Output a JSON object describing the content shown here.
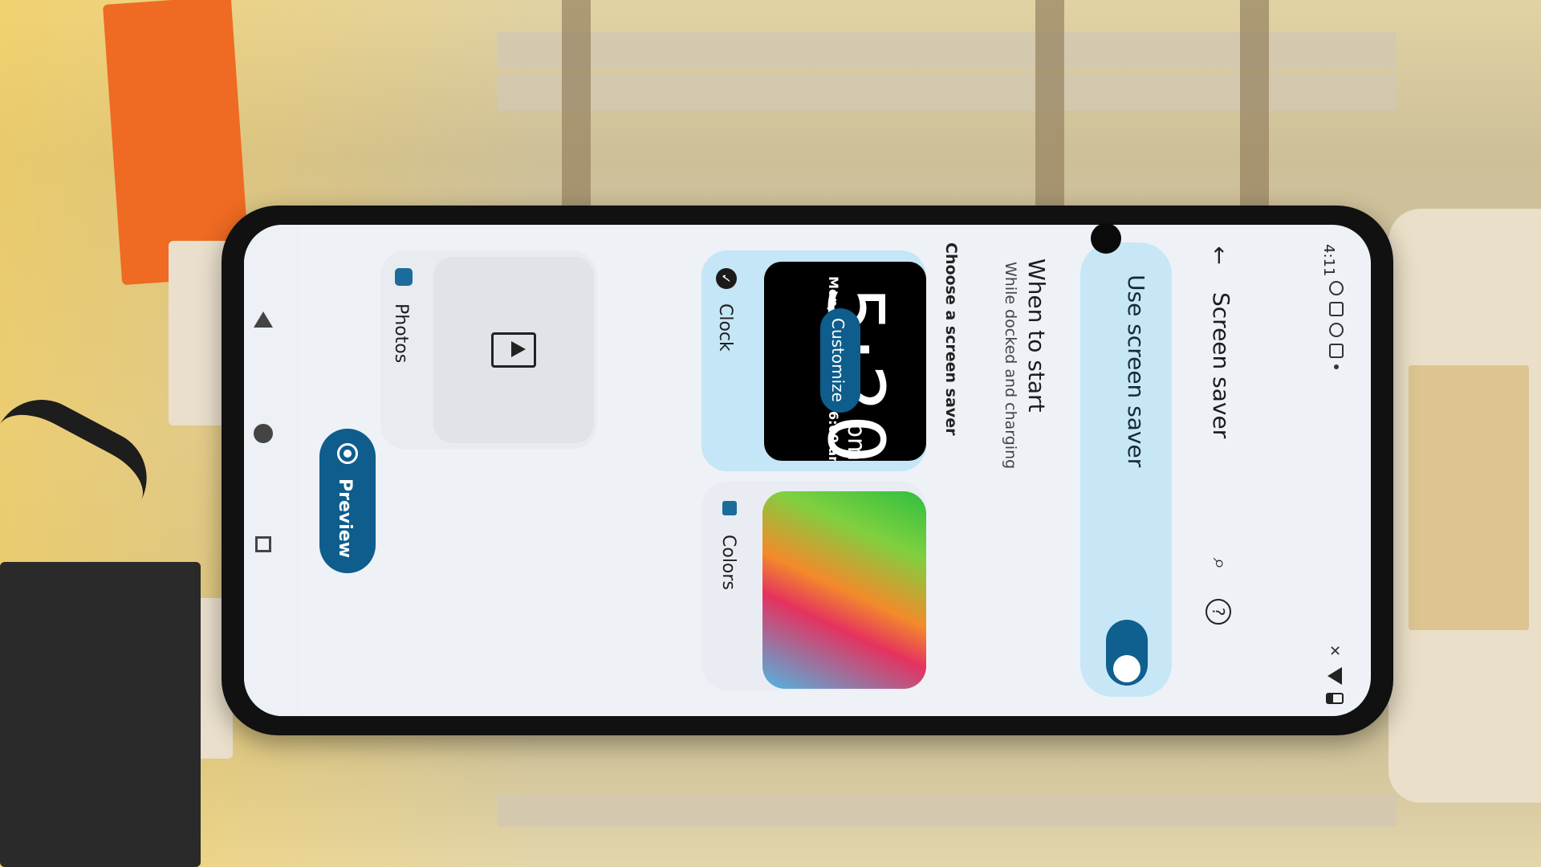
{
  "status": {
    "time": "4:11",
    "icons": [
      "circle-status-icon",
      "image-status-icon",
      "vpn-status-icon",
      "battery-saver-status-icon",
      "dot-status-icon"
    ],
    "right_icons": [
      "mute-icon",
      "wifi-icon",
      "battery-icon"
    ]
  },
  "toolbar": {
    "title": "Screen saver",
    "back_icon": "arrow-back-icon",
    "search_icon": "search-icon",
    "help_icon": "help-icon"
  },
  "main_toggle": {
    "label": "Use screen saver",
    "enabled": true
  },
  "when_to_start": {
    "title": "When to start",
    "subtitle": "While docked and charging"
  },
  "choose": {
    "label": "Choose a screen saver"
  },
  "options": {
    "clock": {
      "name": "Clock",
      "selected": true,
      "preview_time": "5:20",
      "preview_ampm": "pm",
      "preview_date": "Mon, 4 July  ⏰ Tue 6:00 am",
      "customize_label": "Customize"
    },
    "colors": {
      "name": "Colors",
      "selected": false
    },
    "photos": {
      "name": "Photos",
      "selected": false
    }
  },
  "preview_button": {
    "label": "Preview"
  },
  "colors": {
    "accent": "#0e5d8c",
    "toggle_card": "#c7e7f7",
    "screen_bg": "#eef1f6"
  }
}
